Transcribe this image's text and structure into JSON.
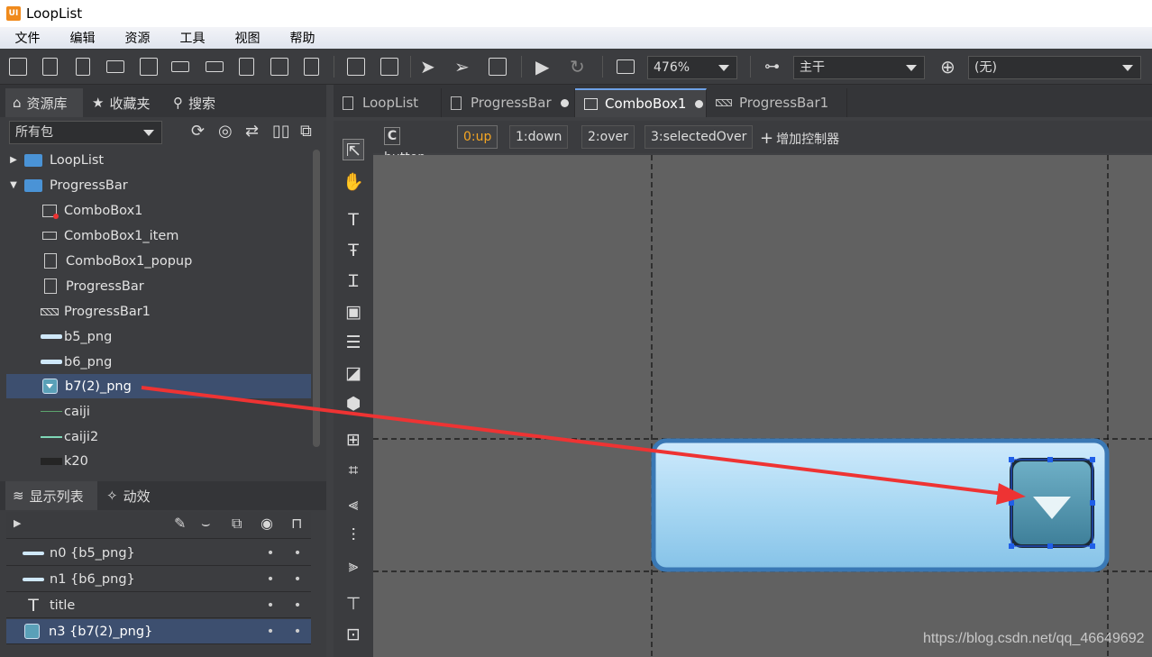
{
  "window": {
    "title": "LoopList",
    "logo": "UI"
  },
  "menu": [
    "文件",
    "编辑",
    "资源",
    "工具",
    "视图",
    "帮助"
  ],
  "toolbar": {
    "zoom": "476%",
    "branch": "主干",
    "language": "(无)"
  },
  "left_tabs": {
    "library": "资源库",
    "favorites": "收藏夹",
    "search": "搜索"
  },
  "package_select": "所有包",
  "tree": [
    {
      "label": "LoopList",
      "type": "package",
      "expanded": false
    },
    {
      "label": "ProgressBar",
      "type": "package",
      "expanded": true
    },
    {
      "label": "ComboBox1",
      "type": "combobox"
    },
    {
      "label": "ComboBox1_item",
      "type": "button"
    },
    {
      "label": "ComboBox1_popup",
      "type": "component"
    },
    {
      "label": "ProgressBar",
      "type": "component"
    },
    {
      "label": "ProgressBar1",
      "type": "progressbar"
    },
    {
      "label": "b5_png",
      "type": "image"
    },
    {
      "label": "b6_png",
      "type": "image"
    },
    {
      "label": "b7(2)_png",
      "type": "image",
      "selected": true
    },
    {
      "label": "caiji",
      "type": "image"
    },
    {
      "label": "caiji2",
      "type": "image"
    },
    {
      "label": "k20",
      "type": "image"
    }
  ],
  "bottom_tabs": {
    "display_list": "显示列表",
    "transitions": "动效"
  },
  "display_list": [
    {
      "label": "n0 {b5_png}",
      "icon": "image"
    },
    {
      "label": "n1 {b6_png}",
      "icon": "image"
    },
    {
      "label": "title",
      "icon": "text"
    },
    {
      "label": "n3 {b7(2)_png}",
      "icon": "image",
      "selected": true
    }
  ],
  "doc_tabs": [
    {
      "label": "LoopList",
      "modified": false
    },
    {
      "label": "ProgressBar",
      "modified": true
    },
    {
      "label": "ComboBox1",
      "modified": true,
      "active": true
    },
    {
      "label": "ProgressBar1",
      "modified": false
    }
  ],
  "controller": {
    "icon_letter": "C",
    "name": "button",
    "pages": [
      "0:up",
      "1:down",
      "2:over",
      "3:selectedOver"
    ],
    "add_label": "增加控制器"
  },
  "watermark": "https://blog.csdn.net/qq_46649692",
  "colors": {
    "accent": "#6ea1e6",
    "active_page": "#f5a623",
    "arrow": "#ee3333",
    "selection": "#3d4f6f"
  }
}
